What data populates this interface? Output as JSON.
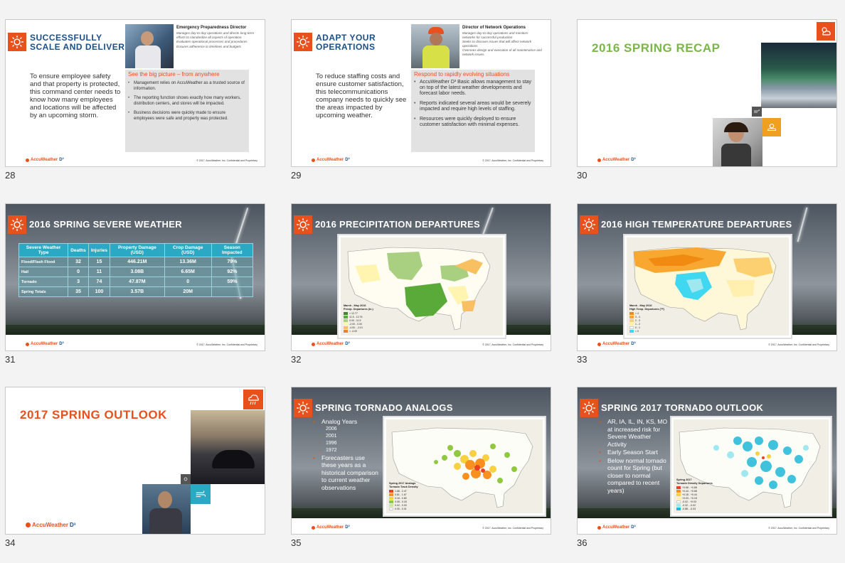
{
  "slides": {
    "s28": {
      "number": "28",
      "title": "SUCCESSFULLY SCALE AND DELIVER",
      "role_title": "Emergency Preparedness Director",
      "role_lines": [
        "Manages day-to-day operations and directs long-term efforts to standardize all aspects of operation.",
        "Evaluates operational processes and procedures",
        "Ensures adherence to timelines and budgets"
      ],
      "body": "To ensure employee safety and that property is protected, this command center needs to know how many employees and locations will be affected by an upcoming storm.",
      "box_heading": "See the big picture – from anywhere",
      "bullets": [
        "Management relies on AccuWeather as a trusted source of information.",
        "The reporting function shows exactly how many workers, distribution centers, and stores will be impacted.",
        "Business decisions were quickly made to ensure employees were safe and property was protected."
      ]
    },
    "s29": {
      "number": "29",
      "title": "ADAPT YOUR OPERATIONS",
      "role_title": "Director of Network Operations",
      "role_lines": [
        "Manages day-to-day operations and monitors networks for successful production",
        "Seeks to discover issues that will affect network operations.",
        "Oversees design and execution of all maintenance and network issues."
      ],
      "body": "To reduce staffing costs and ensure customer satisfaction, this telecommunications company needs to quickly see the areas impacted by upcoming weather.",
      "box_heading": "Respond to rapidly evolving situations",
      "bullets": [
        "AccuWeather D³ Basic allows management to stay on top of the latest weather developments and forecast labor needs.",
        "Reports indicated several areas would be severely impacted and require high levels of staffing.",
        "Resources were quickly deployed to ensure customer satisfaction with minimal expenses."
      ]
    },
    "s30": {
      "number": "30",
      "title": "2016 SPRING RECAP"
    },
    "s31": {
      "number": "31",
      "title": "2016 SPRING SEVERE WEATHER",
      "table": {
        "headers": [
          "Severe Weather Type",
          "Deaths",
          "Injuries",
          "Property Damage (USD)",
          "Crop Damage (USD)",
          "Season Impacted"
        ],
        "rows": [
          [
            "Flood/Flash Flood",
            "32",
            "15",
            "446.21M",
            "13.36M",
            "79%"
          ],
          [
            "Hail",
            "0",
            "11",
            "3.08B",
            "6.65M",
            "92%"
          ],
          [
            "Tornado",
            "3",
            "74",
            "47.87M",
            "0",
            "59%"
          ],
          [
            "Spring Totals",
            "35",
            "100",
            "3.57B",
            "20M",
            ""
          ]
        ]
      }
    },
    "s32": {
      "number": "32",
      "title": "2016 PRECIPITATION DEPARTURES",
      "legend_title": "March - May 2016",
      "legend_sub": "Precip. Departures (in.)",
      "legend": [
        {
          "label": "> 12.77",
          "color": "#3a8a2a"
        },
        {
          "label": "11.5 - 12.76",
          "color": "#5aaa3a"
        },
        {
          "label": "0.00 - 11.5",
          "color": "#a8d080"
        },
        {
          "label": "-2.00 - 0.00",
          "color": "#fff4b0"
        },
        {
          "label": "-4.00 - -2.01",
          "color": "#f8c060"
        },
        {
          "label": "< -4.00",
          "color": "#f08030"
        }
      ]
    },
    "s33": {
      "number": "33",
      "title": "2016 HIGH TEMPERATURE DEPARTURES",
      "legend_title": "March - May 2016",
      "legend_sub": "High Temp. Departures (°F)",
      "legend": [
        {
          "label": "> 4",
          "color": "#f08a10"
        },
        {
          "label": "3 - 4",
          "color": "#f8a830"
        },
        {
          "label": "2 - 3",
          "color": "#fcd070"
        },
        {
          "label": "1 - 2",
          "color": "#fff0b0"
        },
        {
          "label": "0 - 1",
          "color": "#ffffff"
        },
        {
          "label": "< 0",
          "color": "#40d8f0"
        }
      ]
    },
    "s34": {
      "number": "34",
      "title": "2017 SPRING OUTLOOK"
    },
    "s35": {
      "number": "35",
      "title": "SPRING TORNADO ANALOGS",
      "bullets": [
        {
          "text": "Analog Years",
          "sub": false
        },
        {
          "text": "2006",
          "sub": true
        },
        {
          "text": "2001",
          "sub": true
        },
        {
          "text": "1996",
          "sub": true
        },
        {
          "text": "1972",
          "sub": true
        },
        {
          "text": "Forecasters use these years as a historical comparison to current weather observations",
          "sub": false
        }
      ],
      "legend_title": "Spring 2017 Analogs",
      "legend_sub": "Tornado Track Density",
      "legend": [
        {
          "label": "1.68 - 2.47",
          "color": "#e84020"
        },
        {
          "label": "0.81 - 1.67",
          "color": "#f89020"
        },
        {
          "label": "0.18 - 0.80",
          "color": "#f8d040"
        },
        {
          "label": "0.08 - 0.18",
          "color": "#90c840"
        },
        {
          "label": "0.02 - 0.03",
          "color": "#c8e8a0"
        },
        {
          "label": "0.00 - 0.01",
          "color": "#ffffff"
        }
      ]
    },
    "s36": {
      "number": "36",
      "title": "SPRING 2017 TORNADO OUTLOOK",
      "bullets": [
        {
          "text": "AR, IA, IL, IN, KS, MO at increased risk for Severe Weather Activity",
          "sub": false
        },
        {
          "text": "Early Season Start",
          "sub": false
        },
        {
          "text": "Below normal tornado count for Spring (but closer to normal compared to recent years)",
          "sub": false
        }
      ],
      "legend_title": "Spring 2017",
      "legend_sub": "Tornado Density Departures",
      "legend": [
        {
          "label": "+0.68 - +0.88",
          "color": "#e84020"
        },
        {
          "label": "+0.44 - +0.68",
          "color": "#f89020"
        },
        {
          "label": "+0.18 - +0.44",
          "color": "#f8d040"
        },
        {
          "label": "+0.03 - +0.18",
          "color": "#fff0b0"
        },
        {
          "label": "-0.02 - +0.03",
          "color": "#ffffff"
        },
        {
          "label": "-0.32 - -0.02",
          "color": "#a0e8f0"
        },
        {
          "label": "-0.88 - -0.33",
          "color": "#20b8d8"
        }
      ]
    }
  },
  "footer": {
    "brand": "AccuWeather",
    "brand_d": "D³",
    "copyright": "© 2017. AccuWeather, Inc. Confidential and Proprietary"
  },
  "colors": {
    "accent": "#e8501c",
    "navy": "#1a4f8a",
    "green": "#7ab648",
    "teal": "#2aa8c4"
  }
}
